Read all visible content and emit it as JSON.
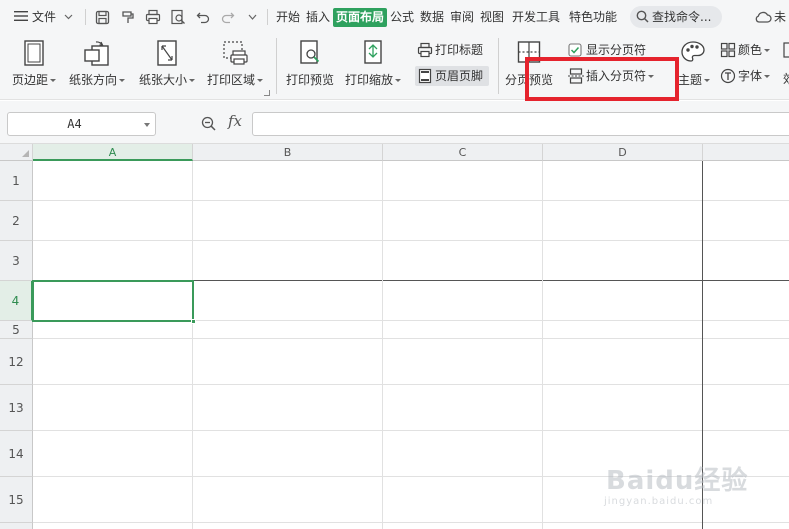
{
  "menubar": {
    "file_label": "文件",
    "tabs": [
      {
        "label": "开始"
      },
      {
        "label": "插入"
      },
      {
        "label": "页面布局",
        "active": true
      },
      {
        "label": "公式"
      },
      {
        "label": "数据"
      },
      {
        "label": "审阅"
      },
      {
        "label": "视图"
      },
      {
        "label": "开发工具"
      },
      {
        "label": "特色功能"
      }
    ],
    "search_placeholder": "查找命令...",
    "right_label": "未",
    "active_color": "#2ea15e"
  },
  "ribbon": {
    "margins_label": "页边距",
    "orientation_label": "纸张方向",
    "size_label": "纸张大小",
    "print_area_label": "打印区域",
    "print_preview_label": "打印预览",
    "print_scale_label": "打印缩放",
    "print_titles_label": "打印标题",
    "header_footer_label": "页眉页脚",
    "page_break_preview_label": "分页预览",
    "show_page_breaks_label": "显示分页符",
    "show_page_breaks_checked": true,
    "insert_page_break_label": "插入分页符",
    "theme_label": "主题",
    "colors_label": "颜色",
    "fonts_label": "字体",
    "effects_label": "效",
    "highlight_color": "#e5232d"
  },
  "formula_bar": {
    "cell_reference": "A4",
    "fx_label": "fx",
    "formula": ""
  },
  "sheet": {
    "columns": [
      "A",
      "B",
      "C",
      "D"
    ],
    "selected_column": "A",
    "rows": [
      "1",
      "2",
      "3",
      "4",
      "5",
      "12",
      "13",
      "14",
      "15"
    ],
    "selected_row": "4",
    "selected_cell": "A4",
    "selection_color": "#3a9a5a"
  },
  "watermark": {
    "main": "Baidu经验",
    "sub": "jingyan.baidu.com"
  }
}
